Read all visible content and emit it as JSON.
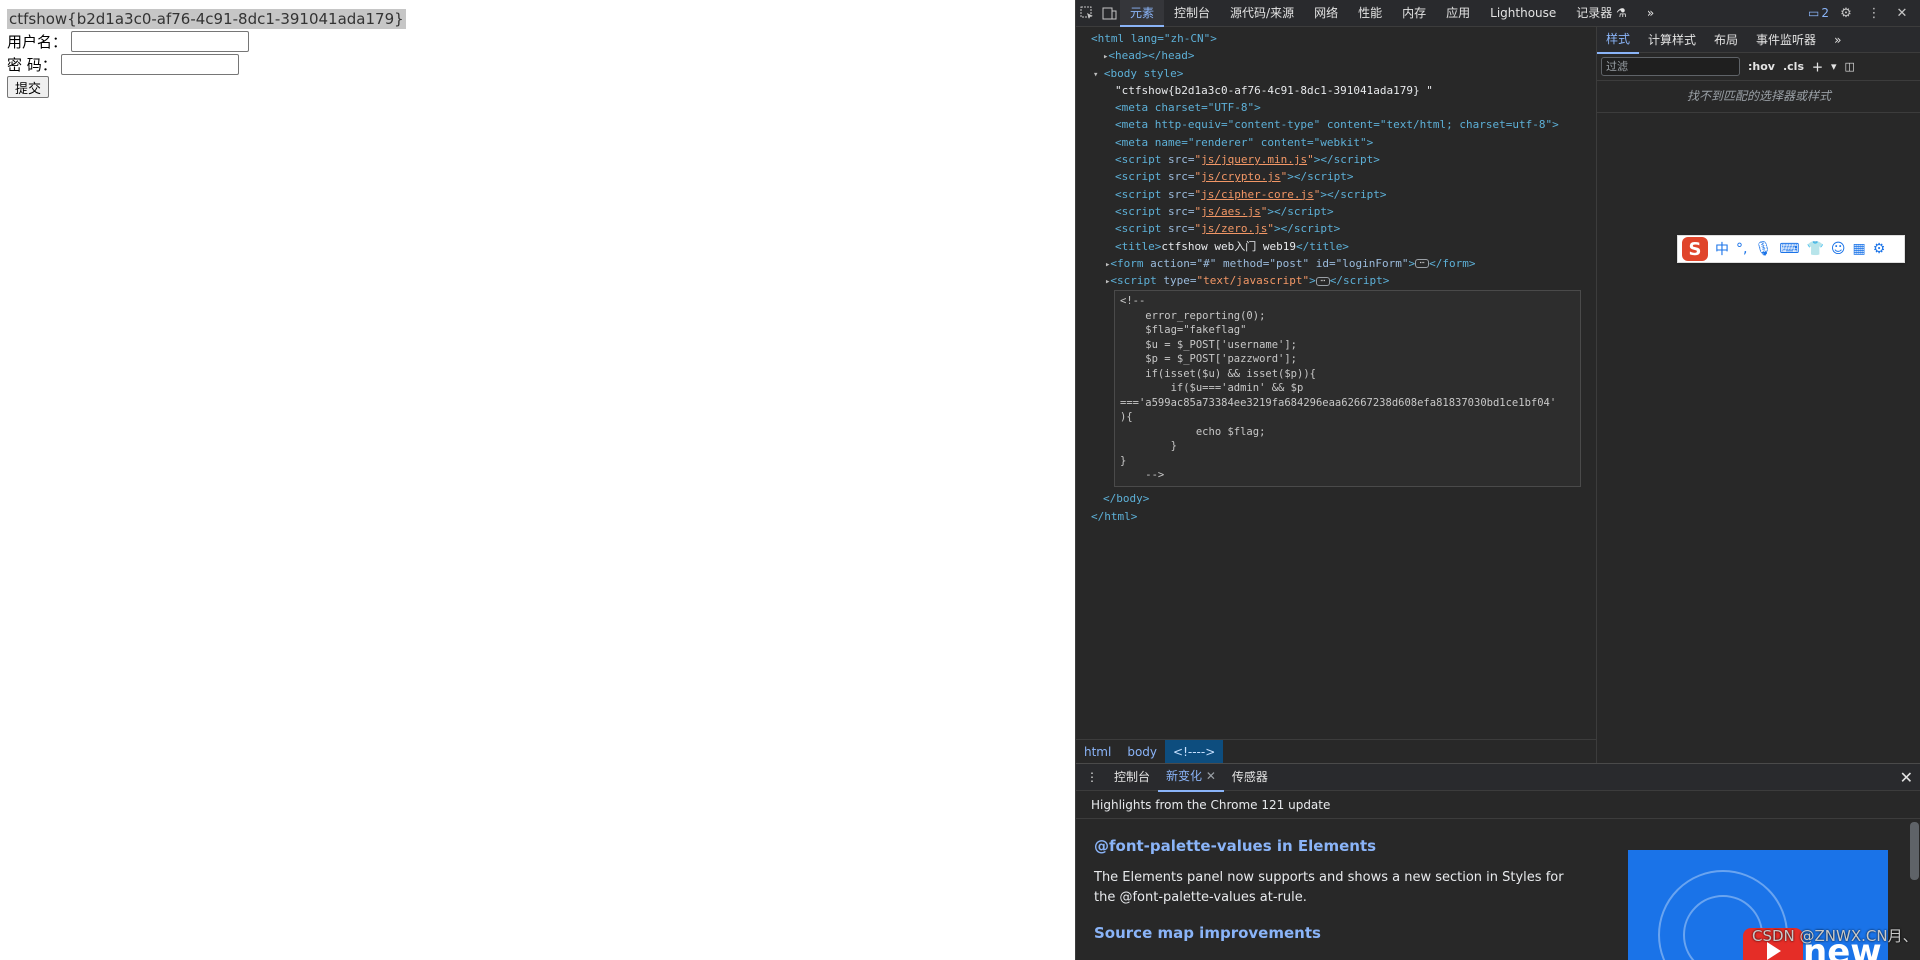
{
  "page": {
    "flag_text": "ctfshow{b2d1a3c0-af76-4c91-8dc1-391041ada179}",
    "username_label": "用户名：",
    "password_label": "密 码：",
    "submit_label": "提交"
  },
  "devtools": {
    "tabs": [
      "元素",
      "控制台",
      "源代码/来源",
      "网络",
      "性能",
      "内存",
      "应用",
      "Lighthouse",
      "记录器 ⚗"
    ],
    "more_tabs": "»",
    "issues_count": "2",
    "tree": {
      "html_open": "<html lang=\"zh-CN\">",
      "head": "<head></head>",
      "body_open": "<body style>",
      "body_text": "\"ctfshow{b2d1a3c0-af76-4c91-8dc1-391041ada179} \"",
      "meta1": "<meta charset=\"UTF-8\">",
      "meta2": "<meta http-equiv=\"content-type\" content=\"text/html; charset=utf-8\">",
      "meta3": "<meta name=\"renderer\" content=\"webkit\">",
      "scripts": [
        "js/jquery.min.js",
        "js/crypto.js",
        "js/cipher-core.js",
        "js/aes.js",
        "js/zero.js"
      ],
      "title_text": "ctfshow web入门 web19",
      "form_attrs": "action=\"#\" method=\"post\" id=\"loginForm\"",
      "script_type": "text/javascript",
      "comment": "<!--\n    error_reporting(0);\n    $flag=\"fakeflag\"\n    $u = $_POST['username'];\n    $p = $_POST['pazzword'];\n    if(isset($u) && isset($p)){\n        if($u==='admin' && $p\n==='a599ac85a73384ee3219fa684296eaa62667238d608efa81837030bd1ce1bf04'\n){\n            echo $flag;\n        }\n}\n    -->",
      "body_close": "</body>",
      "html_close": "</html>"
    },
    "breadcrumbs": [
      "html",
      "body",
      "<!---->"
    ],
    "styles_tabs": [
      "样式",
      "计算样式",
      "布局",
      "事件监听器"
    ],
    "styles_more": "»",
    "filter_placeholder": "过滤",
    "hov_label": ":hov",
    "cls_label": ".cls",
    "no_match_text": "找不到匹配的选择器或样式",
    "drawer": {
      "tabs": [
        "控制台",
        "新变化",
        "传感器"
      ],
      "subtitle": "Highlights from the Chrome 121 update",
      "heading1": "@font-palette-values in Elements",
      "para1": "The Elements panel now supports and shows a new section in Styles for the @font-palette-values at-rule.",
      "heading2": "Source map improvements",
      "promo_text": "new"
    }
  },
  "watermark": "CSDN @ZNWX.CN月、",
  "colors": {
    "accent": "#8ab4f8",
    "devtools_bg": "#282828",
    "tag": "#5db0d7",
    "attr_value": "#f29766"
  }
}
